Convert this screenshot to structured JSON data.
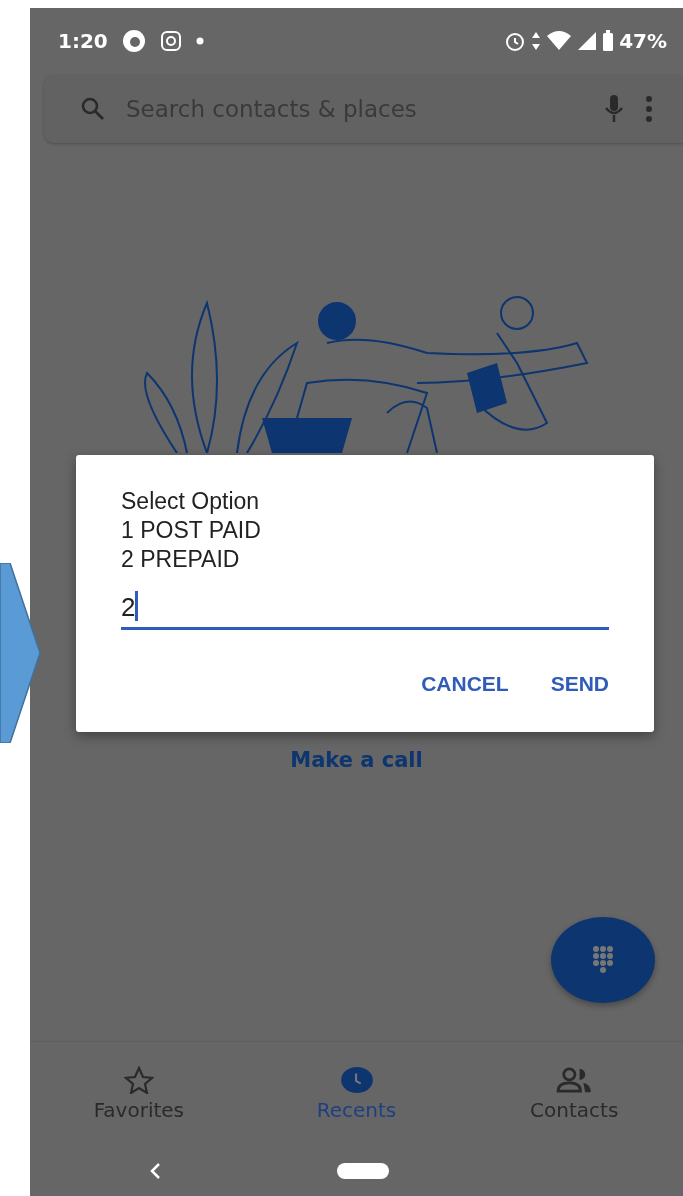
{
  "status_bar": {
    "time": "1:20",
    "battery": "47%"
  },
  "search": {
    "placeholder": "Search contacts & places"
  },
  "empty_state": {
    "action": "Make a call"
  },
  "dialog": {
    "lines": [
      "Select Option",
      "1 POST PAID",
      "2 PREPAID"
    ],
    "input": {
      "value": "2"
    },
    "buttons": [
      {
        "label": "CANCEL"
      },
      {
        "label": "SEND"
      }
    ]
  },
  "bottom_nav": [
    {
      "label": "Favorites",
      "kind": "favorites",
      "selected": false
    },
    {
      "label": "Recents",
      "kind": "recents",
      "selected": true
    },
    {
      "label": "Contacts",
      "kind": "contacts",
      "selected": false
    }
  ]
}
